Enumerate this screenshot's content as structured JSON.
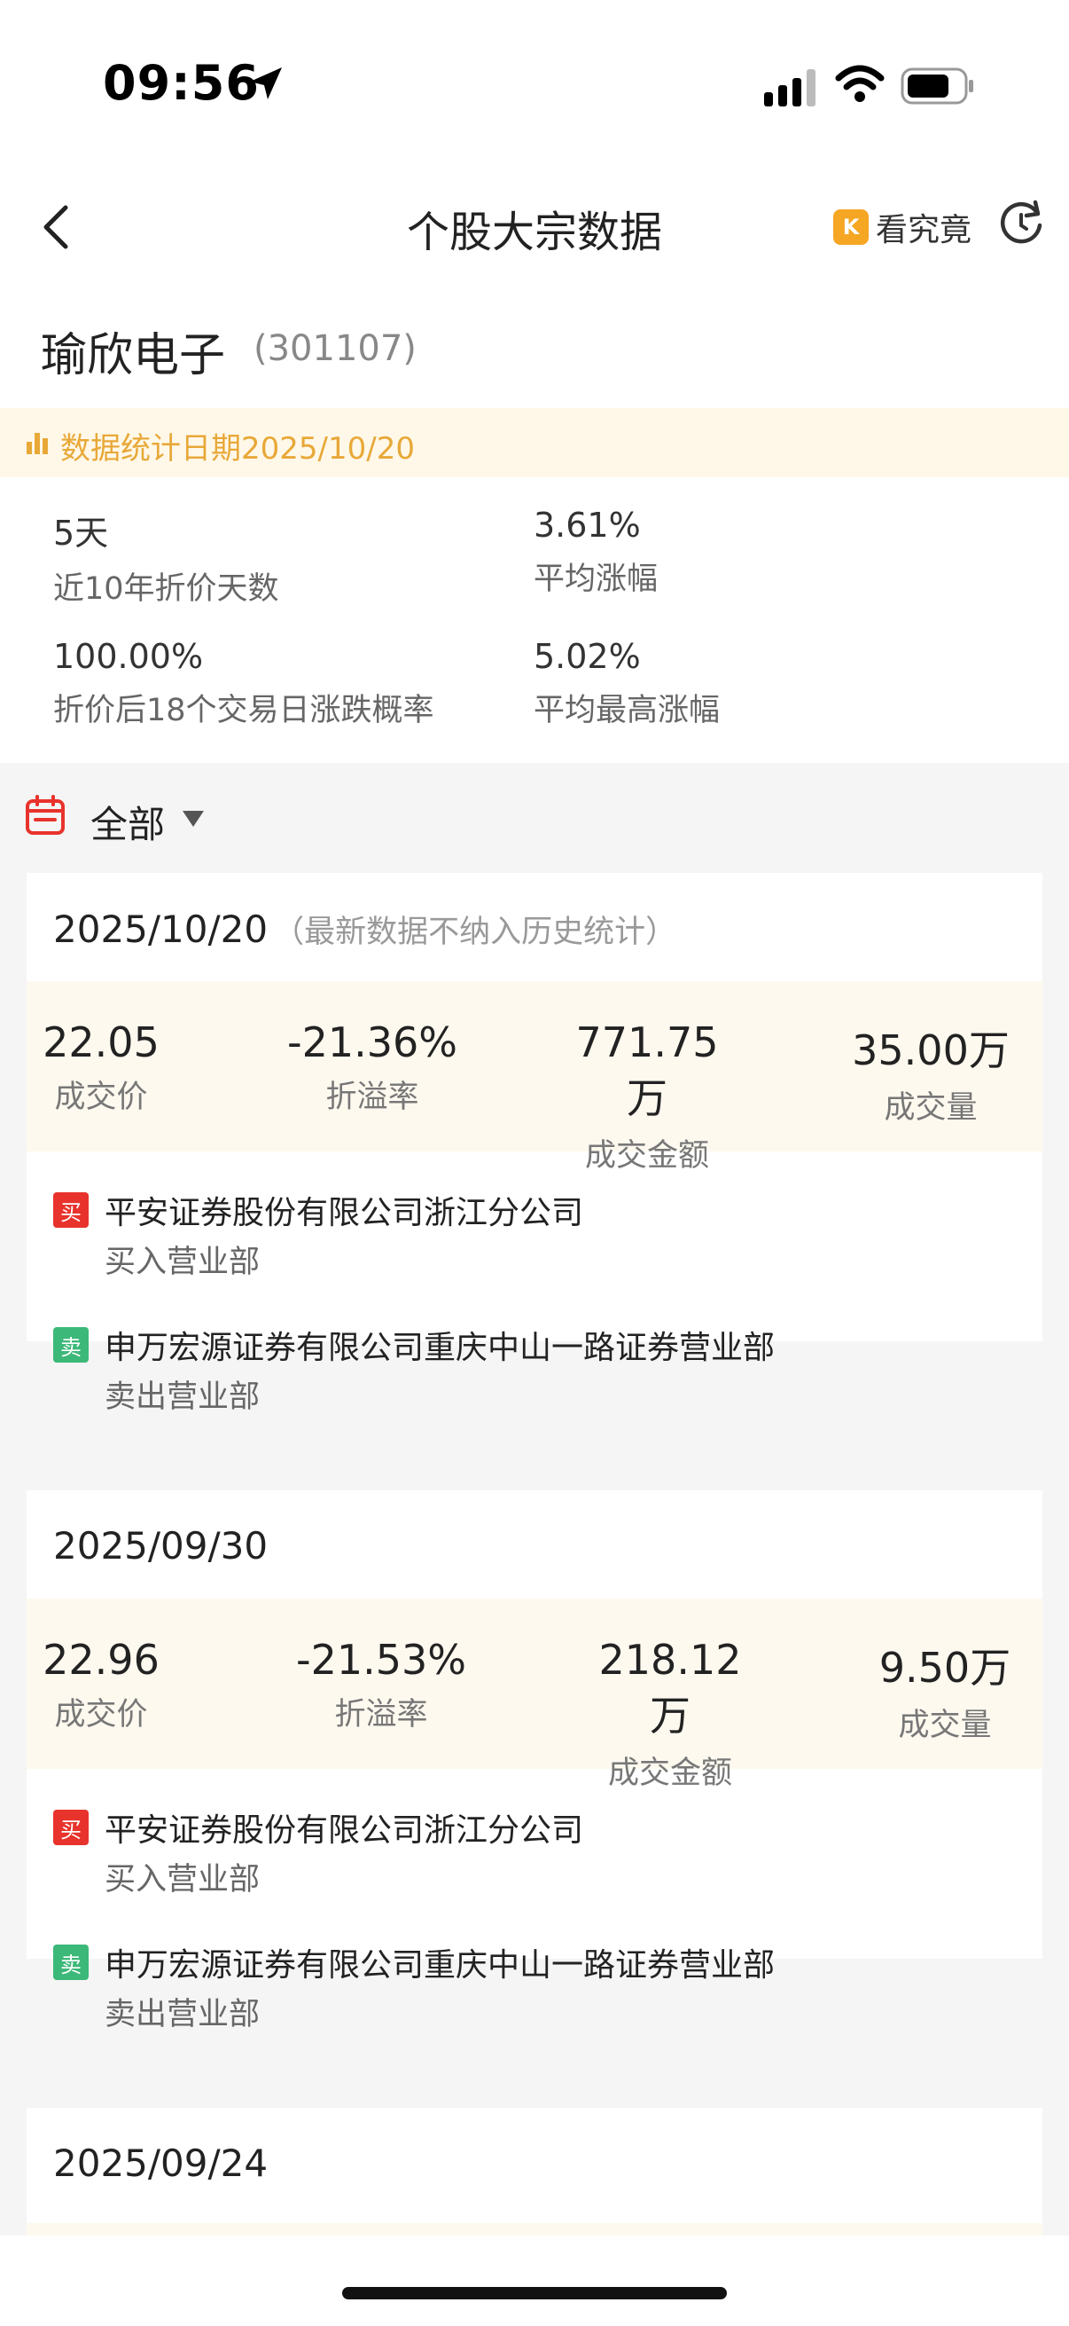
{
  "status_bar": {
    "time": "09:56"
  },
  "nav": {
    "title": "个股大宗数据",
    "kjj_label": "看究竟",
    "kjj_logo": "K"
  },
  "stock": {
    "name": "瑜欣电子",
    "code": "(301107)"
  },
  "banner": {
    "text": "数据统计日期2025/10/20",
    "accent": "#e8a838"
  },
  "stats": [
    {
      "value": "5天",
      "label": "近10年折价天数"
    },
    {
      "value": "3.61%",
      "label": "平均涨幅"
    },
    {
      "value": "100.00%",
      "label": "折价后18个交易日涨跌概率"
    },
    {
      "value": "5.02%",
      "label": "平均最高涨幅"
    }
  ],
  "filter": {
    "label": "全部"
  },
  "cards": [
    {
      "date": "2025/10/20",
      "note": "（最新数据不纳入历史统计）",
      "metrics": [
        {
          "value": "22.05",
          "label": "成交价"
        },
        {
          "value": "-21.36%",
          "label": "折溢率"
        },
        {
          "value": "771.75万",
          "label": "成交金额"
        },
        {
          "value": "35.00万",
          "label": "成交量"
        }
      ],
      "buy": {
        "badge": "买",
        "name": "平安证券股份有限公司浙江分公司",
        "role": "买入营业部"
      },
      "sell": {
        "badge": "卖",
        "name": "申万宏源证券有限公司重庆中山一路证券营业部",
        "role": "卖出营业部"
      }
    },
    {
      "date": "2025/09/30",
      "metrics": [
        {
          "value": "22.96",
          "label": "成交价"
        },
        {
          "value": "-21.53%",
          "label": "折溢率"
        },
        {
          "value": "218.12万",
          "label": "成交金额"
        },
        {
          "value": "9.50万",
          "label": "成交量"
        }
      ],
      "buy": {
        "badge": "买",
        "name": "平安证券股份有限公司浙江分公司",
        "role": "买入营业部"
      },
      "sell": {
        "badge": "卖",
        "name": "申万宏源证券有限公司重庆中山一路证券营业部",
        "role": "卖出营业部"
      }
    },
    {
      "date": "2025/09/24"
    }
  ],
  "colors": {
    "buy": "#e8332c",
    "sell": "#3cb878",
    "metrics_bg": "#fef9ef"
  }
}
